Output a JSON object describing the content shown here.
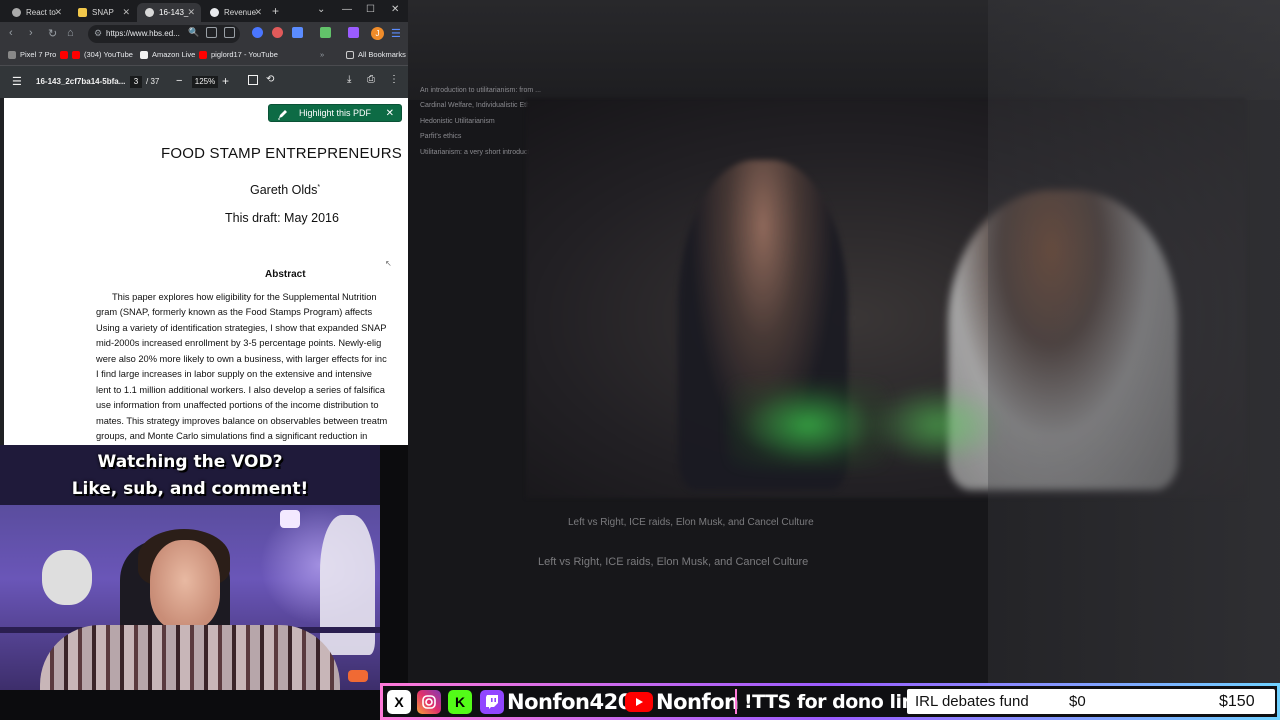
{
  "browser": {
    "tabs": [
      {
        "label": "React to",
        "color": "#aaaaaa"
      },
      {
        "label": "SNAP",
        "color": "#f2c84b"
      },
      {
        "label": "16-143_",
        "color": "#d9d9d9"
      },
      {
        "label": "Revenue",
        "color": "#e8eaed"
      }
    ],
    "url": "https://www.hbs.ed...",
    "profile_initial": "J",
    "bookmarks": [
      "Pixel 7 Pro",
      "(304) YouTube",
      "Amazon Live",
      "piglord17 - YouTube"
    ],
    "all_bookmarks": "All Bookmarks"
  },
  "pdf": {
    "filename": "16-143_2cf7ba14-5bfa...",
    "page": "3",
    "page_total": "/ 37",
    "zoom": "125%",
    "highlight_button": "Highlight this PDF",
    "title": "FOOD STAMP ENTREPRENEURS",
    "author": "Gareth Olds",
    "author_mark": "*",
    "draft": "This draft: May 2016",
    "abstract_heading": "Abstract",
    "abstract_lines": [
      "This paper explores how eligibility for the Supplemental Nutrition",
      "gram (SNAP, formerly known as the Food Stamps Program) affects",
      "Using a variety of identification strategies, I show that expanded SNAP",
      "mid-2000s increased enrollment by 3-5 percentage points. Newly-elig",
      "were also 20% more likely to own a business, with larger effects for inc",
      "I find large increases in labor supply on the extensive and intensive",
      "lent to 1.1 million additional workers. I also develop a series of falsifica",
      "use information from unaffected portions of the income distribution to",
      "mates. This strategy improves balance on observables between treatm",
      "groups, and Monte Carlo simulations find a significant reduction in"
    ]
  },
  "background_video": {
    "list_rows": [
      "An introduction to utilitarianism: from ...",
      "Cardinal Welfare, Individualistic Ethics ...",
      "Hedonistic Utilitarianism",
      "Parfit's ethics",
      "Utilitarianism: a very short introduction"
    ],
    "titles": [
      "Left vs Right, ICE raids, Elon Musk, and Cancel Culture",
      "Left vs Right, ICE raids, Elon Musk, and Cancel Culture"
    ]
  },
  "webcam": {
    "caption_line1": "Watching the VOD?",
    "caption_line2": "Like, sub, and comment!"
  },
  "streambar": {
    "x_icon": "X",
    "kick_icon": "K",
    "twitch_handle": "Nonfon420",
    "youtube_handle": "Nonfon",
    "tts_text": "!TTS for dono link",
    "fund_label": "IRL debates fund",
    "fund_current": "$0",
    "fund_goal": "$150"
  },
  "colors": {
    "highlight_button": "#0d6b45",
    "stream_gradient": [
      "#ff7ad9",
      "#9b5cff",
      "#6fd1ff"
    ],
    "youtube_red": "#ff0000",
    "twitch_purple": "#9146ff",
    "kick_green": "#53fc18"
  }
}
